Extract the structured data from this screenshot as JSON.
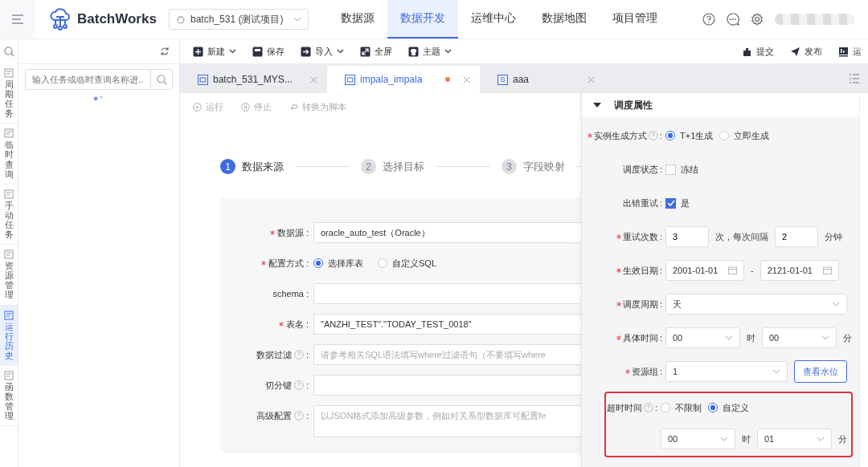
{
  "header": {
    "brand": "BatchWorks",
    "project": "batch_531 (测试项目)",
    "nav": [
      {
        "label": "数据源",
        "selected": false
      },
      {
        "label": "数据开发",
        "selected": true
      },
      {
        "label": "运维中心",
        "selected": false
      },
      {
        "label": "数据地图",
        "selected": false
      },
      {
        "label": "项目管理",
        "selected": false
      }
    ]
  },
  "rail": [
    {
      "label": "周期任务",
      "selected": false
    },
    {
      "label": "临时查询",
      "selected": false
    },
    {
      "label": "手动任务",
      "selected": false
    },
    {
      "label": "资源管理",
      "selected": false
    },
    {
      "label": "运行历史",
      "selected": true
    },
    {
      "label": "函数管理",
      "selected": false
    }
  ],
  "tree": {
    "placeholder": "输入任务或临时查询名称进..."
  },
  "toolbar": {
    "left": [
      {
        "label": "新建",
        "kind": "new",
        "dropdown": true
      },
      {
        "label": "保存",
        "kind": "save",
        "dropdown": false
      },
      {
        "label": "导入",
        "kind": "import",
        "dropdown": true
      },
      {
        "label": "全屏",
        "kind": "fullscreen",
        "dropdown": false
      },
      {
        "label": "主题",
        "kind": "theme",
        "dropdown": true
      }
    ],
    "right": [
      {
        "label": "提交",
        "kind": "submit"
      },
      {
        "label": "发布",
        "kind": "publish"
      },
      {
        "label": "运",
        "kind": "ops"
      }
    ]
  },
  "tabs": [
    {
      "label": "batch_531_MYS...",
      "selected": false,
      "modified": false
    },
    {
      "label": "impala_impala",
      "selected": true,
      "modified": true
    },
    {
      "label": "aaa",
      "selected": false,
      "modified": false,
      "badge": "S"
    }
  ],
  "actions": [
    {
      "label": "运行",
      "kind": "run",
      "disabled": true
    },
    {
      "label": "停止",
      "kind": "stop",
      "disabled": true
    },
    {
      "label": "转换为脚本",
      "kind": "convert",
      "disabled": true
    }
  ],
  "steps": [
    {
      "number": "1",
      "label": "数据来源",
      "selected": true
    },
    {
      "number": "2",
      "label": "选择目标",
      "selected": false
    },
    {
      "number": "3",
      "label": "字段映射",
      "selected": false
    }
  ],
  "source_form": [
    {
      "label": "数据源",
      "suffix": ":",
      "required": true,
      "help": false,
      "parts": [
        {
          "kind": "input",
          "value": "oracle_auto_test（Oracle）"
        }
      ]
    },
    {
      "label": "配置方式",
      "suffix": ":",
      "required": true,
      "help": false,
      "parts": [
        {
          "kind": "radio",
          "label": "选择库表",
          "selected": true
        },
        {
          "kind": "radio",
          "label": "自定义SQL",
          "selected": false
        }
      ]
    },
    {
      "label": "schema",
      "suffix": ":",
      "required": false,
      "help": false,
      "parts": [
        {
          "kind": "input"
        }
      ]
    },
    {
      "label": "表名",
      "suffix": ":",
      "required": true,
      "help": false,
      "parts": [
        {
          "kind": "input",
          "value": "\"ANZHI_TEST\".\"TODAY_TEST_0018\""
        }
      ]
    },
    {
      "label": "数据过滤",
      "suffix": ":",
      "required": false,
      "help": true,
      "parts": [
        {
          "kind": "input",
          "placeholder": "请参考相关SQL语法填写where过滤语句（不要填写where"
        }
      ]
    },
    {
      "label": "切分键",
      "suffix": ":",
      "required": false,
      "help": true,
      "parts": [
        {
          "kind": "input"
        }
      ]
    },
    {
      "label": "高级配置",
      "suffix": ":",
      "required": false,
      "help": true,
      "parts": [
        {
          "kind": "textarea",
          "placeholder": "以JSON格式添加高级参数，例如对关系型数据库可配置fe"
        }
      ]
    }
  ],
  "schedule": {
    "title": "调度属性",
    "expanded": true,
    "fields": [
      {
        "label": "实例生成方式",
        "suffix": ":",
        "required": true,
        "help": true,
        "highlighted": false,
        "parts": [
          {
            "kind": "radio",
            "label": "T+1生成",
            "selected": true
          },
          {
            "kind": "radio",
            "label": "立即生成",
            "selected": false
          }
        ]
      },
      {
        "label": "调度状态",
        "suffix": ":",
        "required": false,
        "help": false,
        "highlighted": false,
        "parts": [
          {
            "kind": "checkbox",
            "label": "冻结",
            "checked": false
          }
        ]
      },
      {
        "label": "出错重试",
        "suffix": ":",
        "required": false,
        "help": false,
        "highlighted": false,
        "parts": [
          {
            "kind": "checkbox",
            "label": "是",
            "checked": true
          }
        ]
      },
      {
        "label": "重试次数",
        "suffix": ":",
        "required": true,
        "help": false,
        "highlighted": false,
        "parts": [
          {
            "kind": "input",
            "value": "3"
          },
          {
            "kind": "text",
            "value": "次，每次间隔"
          },
          {
            "kind": "input",
            "value": "2"
          },
          {
            "kind": "text",
            "value": "分钟"
          }
        ]
      },
      {
        "label": "生效日期",
        "suffix": ":",
        "required": true,
        "help": false,
        "highlighted": false,
        "parts": [
          {
            "kind": "date",
            "value": "2001-01-01"
          },
          {
            "kind": "text",
            "value": "-"
          },
          {
            "kind": "date",
            "value": "2121-01-01"
          }
        ]
      },
      {
        "label": "调度周期",
        "suffix": ":",
        "required": true,
        "help": false,
        "highlighted": false,
        "parts": [
          {
            "kind": "select",
            "value": "天",
            "wide": true
          }
        ]
      },
      {
        "label": "具体时间",
        "suffix": ":",
        "required": true,
        "help": false,
        "highlighted": false,
        "parts": [
          {
            "kind": "select",
            "value": "00",
            "wide": false
          },
          {
            "kind": "text",
            "value": "时"
          },
          {
            "kind": "select",
            "value": "00",
            "wide": false
          },
          {
            "kind": "text",
            "value": "分"
          }
        ]
      },
      {
        "label": "资源组",
        "suffix": ":",
        "required": true,
        "help": false,
        "highlighted": false,
        "parts": [
          {
            "kind": "select",
            "value": "1",
            "wide": true
          },
          {
            "kind": "button",
            "label": "查看水位"
          }
        ]
      },
      {
        "label": "超时时间",
        "suffix": ":",
        "required": false,
        "help": true,
        "highlighted": true,
        "parts": [
          {
            "kind": "radio",
            "label": "不限制",
            "selected": false
          },
          {
            "kind": "radio",
            "label": "自定义",
            "selected": true
          }
        ],
        "sub_parts": [
          {
            "kind": "select",
            "value": "00",
            "wide": false
          },
          {
            "kind": "text",
            "value": "时"
          },
          {
            "kind": "select",
            "value": "01",
            "wide": false
          },
          {
            "kind": "text",
            "value": "分"
          }
        ]
      }
    ]
  }
}
